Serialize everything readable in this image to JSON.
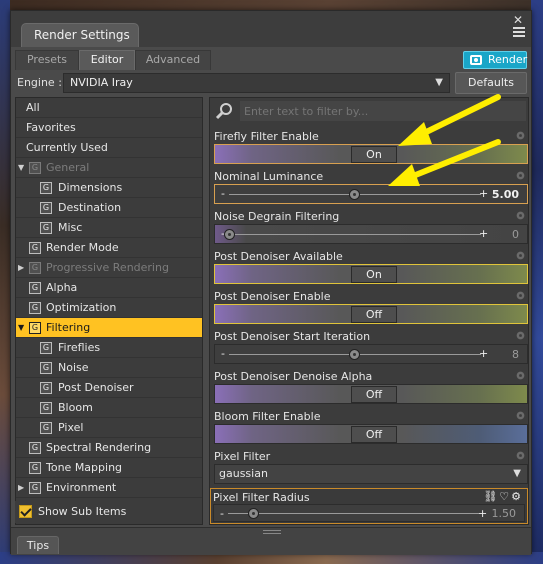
{
  "window": {
    "title": "Render Settings",
    "close_glyph": "✕"
  },
  "tabs": [
    {
      "label": "Presets",
      "active": false
    },
    {
      "label": "Editor",
      "active": true
    },
    {
      "label": "Advanced",
      "active": false
    }
  ],
  "render_button": {
    "label": "Render",
    "icon": "camera-icon",
    "color": "#1aa6c8"
  },
  "engine": {
    "label": "Engine :",
    "selected": "NVIDIA Iray",
    "defaults_label": "Defaults"
  },
  "tree": {
    "items": [
      {
        "label": "All"
      },
      {
        "label": "Favorites"
      },
      {
        "label": "Currently Used"
      },
      {
        "label": "General",
        "dim": true,
        "arrow": "▼"
      },
      {
        "label": "Dimensions"
      },
      {
        "label": "Destination"
      },
      {
        "label": "Misc"
      },
      {
        "label": "Render Mode"
      },
      {
        "label": "Progressive Rendering",
        "dim": true,
        "arrow": "▶"
      },
      {
        "label": "Alpha"
      },
      {
        "label": "Optimization"
      },
      {
        "label": "Filtering",
        "selected": true,
        "arrow": "▼"
      },
      {
        "label": "Fireflies"
      },
      {
        "label": "Noise"
      },
      {
        "label": "Post Denoiser"
      },
      {
        "label": "Bloom"
      },
      {
        "label": "Pixel"
      },
      {
        "label": "Spectral Rendering"
      },
      {
        "label": "Tone Mapping"
      },
      {
        "label": "Environment",
        "arrow": "▶"
      }
    ],
    "show_sub_items": {
      "label": "Show Sub Items",
      "checked": true
    },
    "selected_color": "#ffc222"
  },
  "filter": {
    "placeholder": "Enter text to filter by..."
  },
  "properties": {
    "firefly_filter_enable": {
      "label": "Firefly Filter Enable",
      "value": "On"
    },
    "nominal_luminance": {
      "label": "Nominal Luminance",
      "value": "5.00",
      "minus": "-",
      "plus": "+",
      "position": 0.5
    },
    "noise_degrain_filtering": {
      "label": "Noise Degrain Filtering",
      "value": "0",
      "minus": "-",
      "plus": "+",
      "position": 0.0
    },
    "post_denoiser_available": {
      "label": "Post Denoiser Available",
      "value": "On"
    },
    "post_denoiser_enable": {
      "label": "Post Denoiser Enable",
      "value": "Off"
    },
    "post_denoiser_start_iteration": {
      "label": "Post Denoiser Start Iteration",
      "value": "8",
      "minus": "-",
      "plus": "+",
      "position": 0.5
    },
    "post_denoiser_denoise_alpha": {
      "label": "Post Denoiser Denoise Alpha",
      "value": "Off"
    },
    "bloom_filter_enable": {
      "label": "Bloom Filter Enable",
      "value": "Off"
    },
    "pixel_filter": {
      "label": "Pixel Filter",
      "value": "gaussian"
    },
    "pixel_filter_radius": {
      "label": "Pixel Filter Radius",
      "value": "1.50",
      "minus": "-",
      "plus": "+",
      "position": 0.1,
      "icons": "⛓♡⚙"
    }
  },
  "bottom": {
    "tips_label": "Tips"
  },
  "annotation_arrow_color": "#ffee00"
}
